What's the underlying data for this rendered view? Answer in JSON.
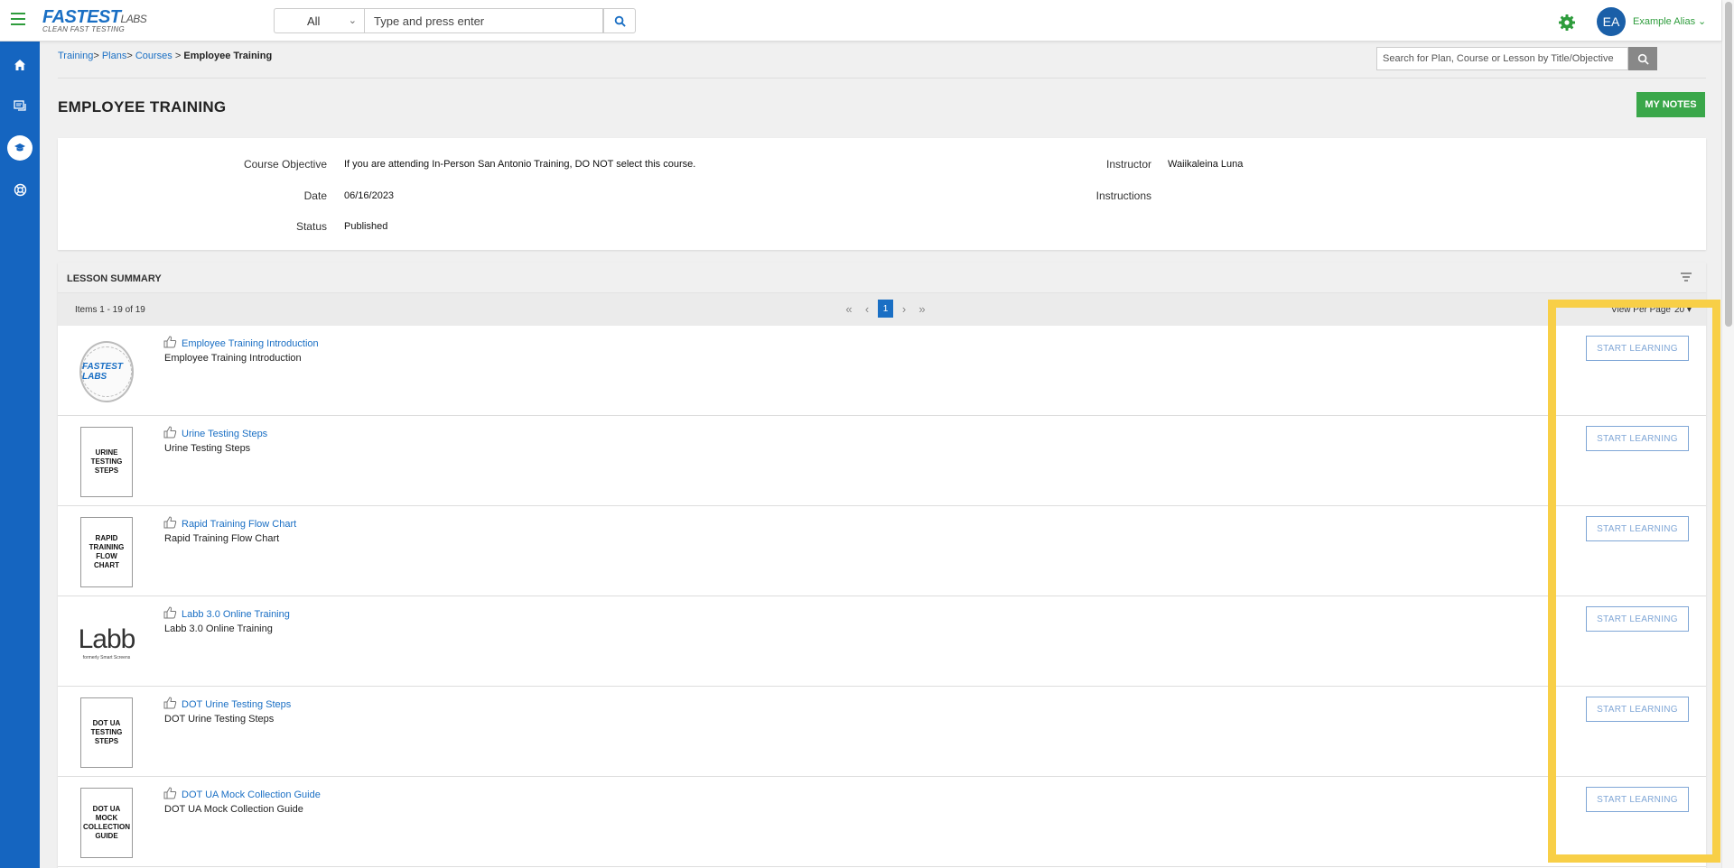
{
  "header": {
    "logo_main": "FASTEST",
    "logo_labs": "LABS",
    "logo_tagline": "CLEAN FAST TESTING",
    "scope_value": "All",
    "search_placeholder": "Type and press enter",
    "user_initials": "EA",
    "user_name": "Example Alias"
  },
  "breadcrumb": {
    "items": [
      "Training",
      "Plans",
      "Courses"
    ],
    "current": "Employee Training"
  },
  "content_search_placeholder": "Search for Plan, Course or Lesson by Title/Objective",
  "page_title": "EMPLOYEE TRAINING",
  "my_notes_label": "MY NOTES",
  "details": {
    "objective_label": "Course Objective",
    "objective_value": "If you are attending In-Person San Antonio Training, DO NOT select this course.",
    "date_label": "Date",
    "date_value": "06/16/2023",
    "status_label": "Status",
    "status_value": "Published",
    "instructor_label": "Instructor",
    "instructor_value": "Waiikaleina Luna",
    "instructions_label": "Instructions",
    "instructions_value": ""
  },
  "lesson_summary": {
    "title": "LESSON SUMMARY",
    "items_count": "Items 1 - 19 of 19",
    "current_page": "1",
    "per_page_label": "View Per Page",
    "per_page_value": "20",
    "start_label": "START LEARNING",
    "lessons": [
      {
        "title": "Employee Training Introduction",
        "desc": "Employee Training Introduction",
        "thumb": "seal",
        "thumb_text": "FASTEST LABS"
      },
      {
        "title": "Urine Testing Steps",
        "desc": "Urine Testing Steps",
        "thumb": "doc",
        "thumb_text": "URINE TESTING STEPS"
      },
      {
        "title": "Rapid Training Flow Chart",
        "desc": "Rapid Training Flow Chart",
        "thumb": "doc",
        "thumb_text": "RAPID TRAINING FLOW CHART"
      },
      {
        "title": "Labb 3.0 Online Training",
        "desc": "Labb 3.0 Online Training",
        "thumb": "labb",
        "thumb_text": "Labb",
        "thumb_subtext": "formerly Smart Screens"
      },
      {
        "title": "DOT Urine Testing Steps",
        "desc": "DOT Urine Testing Steps",
        "thumb": "doc",
        "thumb_text": "DOT UA TESTING STEPS"
      },
      {
        "title": "DOT UA Mock Collection Guide",
        "desc": "DOT UA Mock Collection Guide",
        "thumb": "doc",
        "thumb_text": "DOT UA MOCK COLLECTION GUIDE"
      }
    ]
  },
  "colors": {
    "brand_blue": "#1565c0",
    "brand_green": "#3aa74a",
    "link_blue": "#1a6fc4",
    "highlight_yellow": "#f8cf47"
  }
}
